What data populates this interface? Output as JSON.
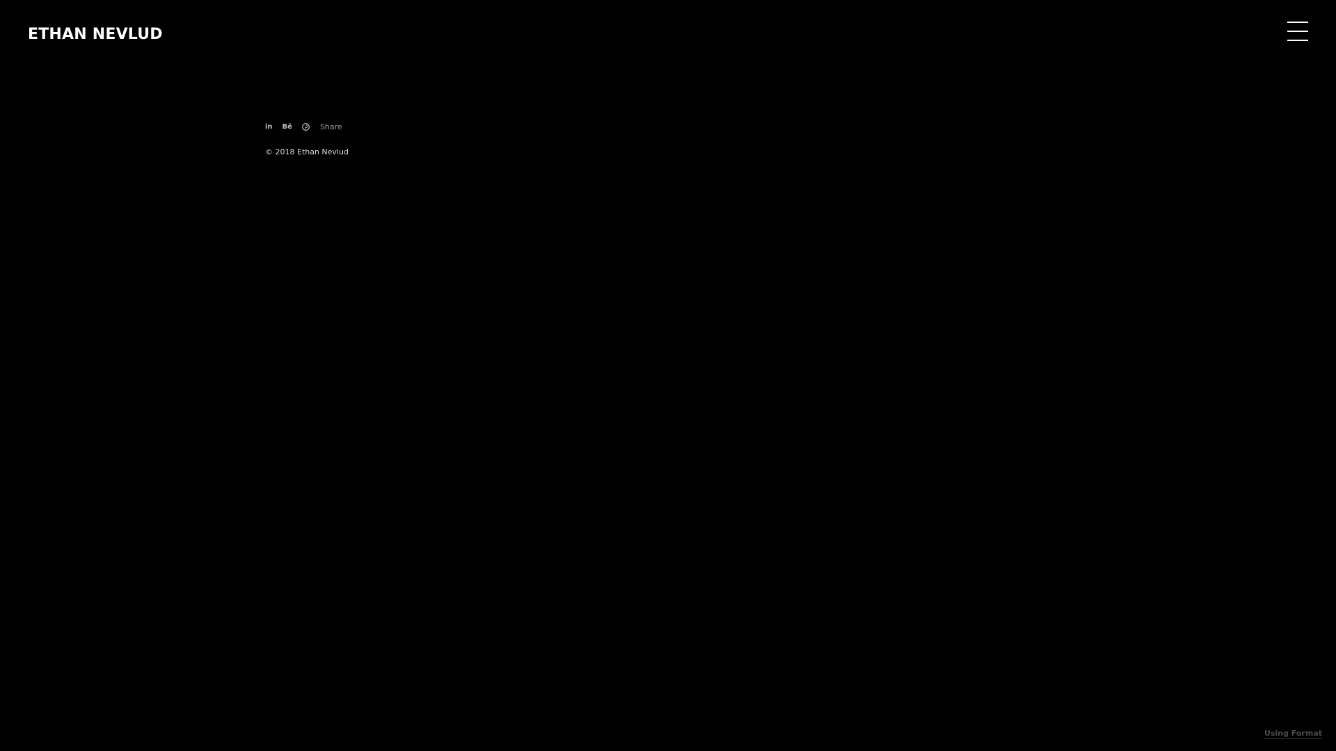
{
  "header": {
    "site_title": "ETHAN NEVLUD",
    "menu_icon": "hamburger-menu-icon"
  },
  "footer": {
    "social": [
      {
        "name": "linkedin",
        "icon": "linkedin-icon",
        "glyph": "in"
      },
      {
        "name": "behance",
        "icon": "behance-icon",
        "glyph": "Bē"
      },
      {
        "name": "pinterest",
        "icon": "pinterest-icon",
        "glyph": ""
      }
    ],
    "share_label": "Share",
    "copyright": "© 2018 Ethan Nevlud"
  },
  "branding": {
    "format_label": "Using Format"
  },
  "colors": {
    "background": "#000000",
    "title": "#ffffff",
    "icon": "#bdbdbd",
    "muted": "#4a4a4a"
  }
}
